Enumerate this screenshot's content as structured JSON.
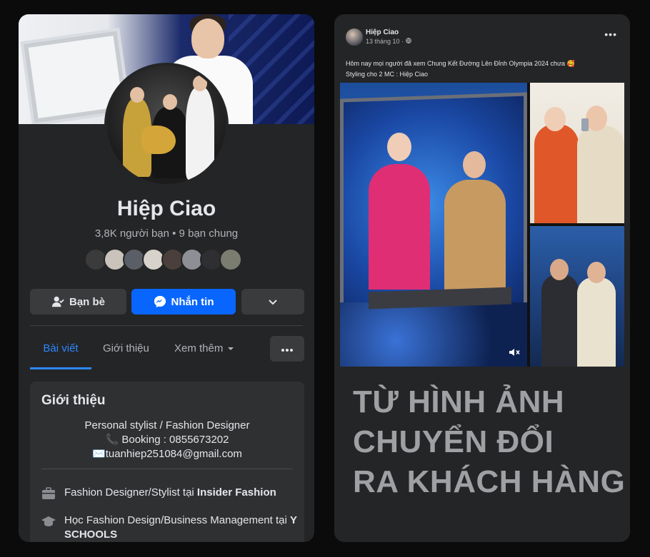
{
  "profile": {
    "name": "Hiệp Ciao",
    "stats": "3,8K người bạn • 9 bạn chung",
    "buttons": {
      "friends_label": "Bạn bè",
      "message_label": "Nhắn tin"
    },
    "tabs": {
      "posts": "Bài viết",
      "about": "Giới thiệu",
      "more": "Xem thêm"
    },
    "intro": {
      "title": "Giới thiệu",
      "bio_line1": "Personal stylist / Fashion Designer",
      "bio_line2": "📞 Booking : 0855673202",
      "bio_line3": "✉️tuanhiep251084@gmail.com",
      "work_prefix": "Fashion Designer/Stylist tại ",
      "work_place": "Insider Fashion",
      "edu_prefix": "Học Fashion Design/Business Management tại ",
      "edu_place": "Y SCHOOLS"
    },
    "icons": [
      "user-check-icon",
      "messenger-icon",
      "chevron-down-icon",
      "caret-down-icon",
      "ellipsis-icon",
      "briefcase-icon",
      "graduation-cap-icon"
    ],
    "accent_color": "#0866ff"
  },
  "post": {
    "author": "Hiệp Ciao",
    "date": "13 tháng 10 ·",
    "text_line1": "Hôm nay mọi người đã xem Chung Kết Đường Lên Đỉnh Olympia 2024 chưa 🥰",
    "text_line2": "Styling cho 2 MC : Hiệp Ciao",
    "menu": "•••",
    "icons": [
      "globe-icon",
      "ellipsis-icon",
      "mute-icon"
    ]
  },
  "headline": {
    "line1": "TỪ HÌNH ẢNH",
    "line2": "CHUYỂN ĐỔI",
    "line3": "RA KHÁCH HÀNG"
  }
}
